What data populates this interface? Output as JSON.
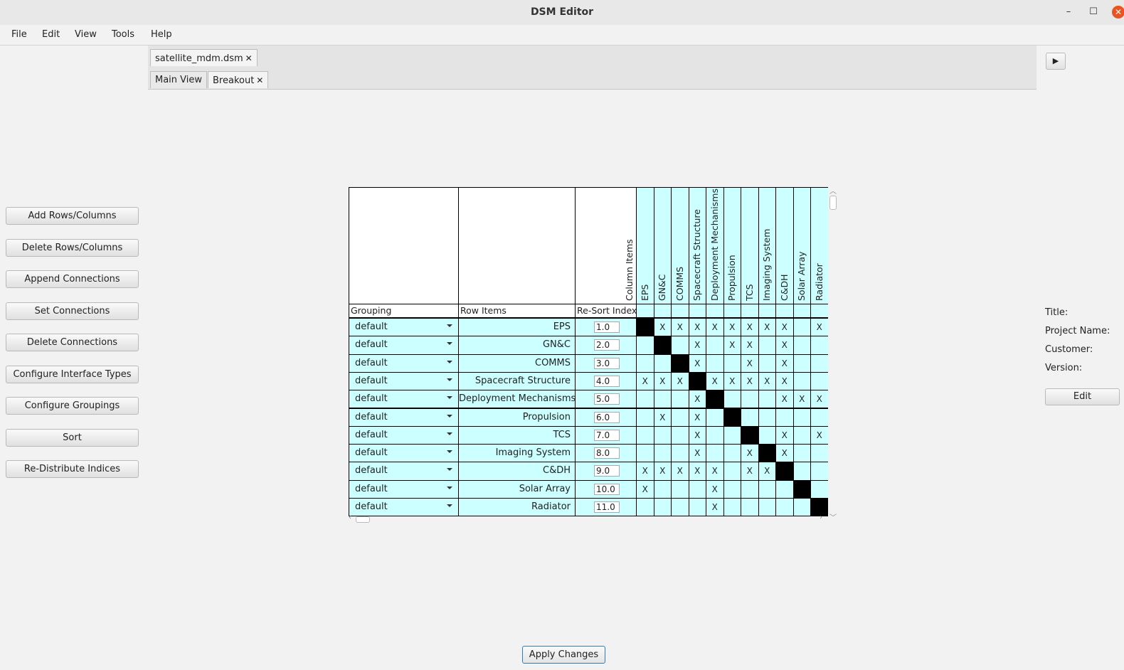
{
  "window": {
    "title": "DSM Editor",
    "minimize": "–",
    "maximize": "☐",
    "close": "✕"
  },
  "menu": [
    "File",
    "Edit",
    "View",
    "Tools",
    "Help"
  ],
  "file_tab": {
    "label": "satellite_mdm.dsm",
    "close": "✕"
  },
  "view_tabs": [
    {
      "label": "Main View"
    },
    {
      "label": "Breakout",
      "close": "✕"
    }
  ],
  "play_button": "▶",
  "side_buttons": [
    "Add Rows/Columns",
    "Delete Rows/Columns",
    "Append Connections",
    "Set Connections",
    "Delete Connections",
    "Configure Interface Types",
    "Configure Groupings",
    "Sort",
    "Re-Distribute Indices"
  ],
  "matrix": {
    "header_labels": {
      "grouping": "Grouping",
      "row_items": "Row Items",
      "resort_index": "Re-Sort Index",
      "column_items": "Column Items"
    },
    "columns": [
      "EPS",
      "GN&C",
      "COMMS",
      "Spacecraft Structure",
      "Deployment Mechanisms",
      "Propulsion",
      "TCS",
      "Imaging System",
      "C&DH",
      "Solar Array",
      "Radiator"
    ],
    "rows": [
      {
        "grouping": "default",
        "name": "EPS",
        "index": "1.0",
        "cells": [
          "",
          "X",
          "X",
          "X",
          "X",
          "X",
          "X",
          "X",
          "X",
          "",
          "X"
        ]
      },
      {
        "grouping": "default",
        "name": "GN&C",
        "index": "2.0",
        "cells": [
          "",
          "",
          "",
          "X",
          "",
          "X",
          "X",
          "",
          "X",
          "",
          ""
        ]
      },
      {
        "grouping": "default",
        "name": "COMMS",
        "index": "3.0",
        "cells": [
          "",
          "",
          "",
          "X",
          "",
          "",
          "X",
          "",
          "X",
          "",
          ""
        ]
      },
      {
        "grouping": "default",
        "name": "Spacecraft Structure",
        "index": "4.0",
        "cells": [
          "X",
          "X",
          "X",
          "",
          "X",
          "X",
          "X",
          "X",
          "X",
          "",
          ""
        ]
      },
      {
        "grouping": "default",
        "name": "Deployment Mechanisms",
        "index": "5.0",
        "cells": [
          "",
          "",
          "",
          "X",
          "",
          "",
          "",
          "",
          "X",
          "X",
          "X"
        ]
      },
      {
        "grouping": "default",
        "name": "Propulsion",
        "index": "6.0",
        "cells": [
          "",
          "X",
          "",
          "X",
          "",
          "",
          "",
          "",
          "",
          "",
          ""
        ]
      },
      {
        "grouping": "default",
        "name": "TCS",
        "index": "7.0",
        "cells": [
          "",
          "",
          "",
          "X",
          "",
          "",
          "",
          "",
          "X",
          "",
          "X"
        ]
      },
      {
        "grouping": "default",
        "name": "Imaging System",
        "index": "8.0",
        "cells": [
          "",
          "",
          "",
          "X",
          "",
          "",
          "X",
          "",
          "X",
          "",
          ""
        ]
      },
      {
        "grouping": "default",
        "name": "C&DH",
        "index": "9.0",
        "cells": [
          "X",
          "X",
          "X",
          "X",
          "X",
          "",
          "X",
          "X",
          "",
          "",
          ""
        ]
      },
      {
        "grouping": "default",
        "name": "Solar Array",
        "index": "10.0",
        "cells": [
          "X",
          "",
          "",
          "",
          "X",
          "",
          "",
          "",
          "",
          "",
          ""
        ]
      },
      {
        "grouping": "default",
        "name": "Radiator",
        "index": "11.0",
        "cells": [
          "",
          "",
          "",
          "",
          "X",
          "",
          "",
          "",
          "",
          "",
          ""
        ]
      }
    ]
  },
  "info_panel": {
    "title_label": "Title:",
    "project_label": "Project Name:",
    "customer_label": "Customer:",
    "version_label": "Version:",
    "edit_button": "Edit"
  },
  "apply_button": "Apply Changes",
  "colors": {
    "matrix_cell": "#ccffff",
    "diagonal": "#000000",
    "apply_border": "#2e7fb8",
    "close_button": "#e95420"
  }
}
